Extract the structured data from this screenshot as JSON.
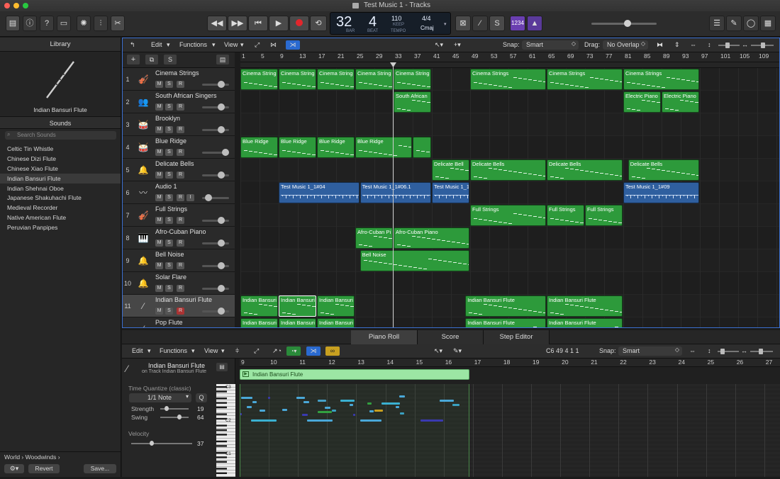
{
  "window": {
    "title": "Test Music 1 - Tracks"
  },
  "lcd": {
    "bar": "32",
    "beat": "4",
    "bar_lbl": "BAR",
    "beat_lbl": "BEAT",
    "tempo": "110",
    "keep": "KEEP",
    "tempo_lbl": "TEMPO",
    "sig": "4/4",
    "key": "Cmaj"
  },
  "controlbar": {
    "midi_badge": "1234"
  },
  "library": {
    "title": "Library",
    "instrument": "Indian Bansuri Flute",
    "sounds_title": "Sounds",
    "search_placeholder": "Search Sounds",
    "sounds": [
      "Celtic Tin Whistle",
      "Chinese Dizi Flute",
      "Chinese Xiao Flute",
      "Indian Bansuri Flute",
      "Indian Shehnai Oboe",
      "Japanese Shakuhachi Flute",
      "Medieval Recorder",
      "Native American Flute",
      "Peruvian Panpipes"
    ],
    "breadcrumb": [
      "World",
      "Woodwinds"
    ],
    "revert": "Revert",
    "save": "Save..."
  },
  "tracks_bar": {
    "edit": "Edit",
    "functions": "Functions",
    "view": "View",
    "snap_lbl": "Snap:",
    "snap": "Smart",
    "drag_lbl": "Drag:",
    "drag": "No Overlap"
  },
  "ruler": [
    "1",
    "5",
    "9",
    "13",
    "17",
    "21",
    "25",
    "29",
    "33",
    "37",
    "41",
    "45",
    "49",
    "53",
    "57",
    "61",
    "65",
    "69",
    "73",
    "77",
    "81",
    "85",
    "89",
    "93",
    "97",
    "101",
    "105",
    "109"
  ],
  "tracks": [
    {
      "num": "1",
      "name": "Cinema Strings",
      "r": "R"
    },
    {
      "num": "2",
      "name": "South African Singers",
      "r": "R"
    },
    {
      "num": "3",
      "name": "Brooklyn",
      "r": "R"
    },
    {
      "num": "4",
      "name": "Blue Ridge",
      "r": "R"
    },
    {
      "num": "5",
      "name": "Delicate Bells",
      "r": "R"
    },
    {
      "num": "6",
      "name": "Audio 1",
      "r": "R",
      "i": "I"
    },
    {
      "num": "7",
      "name": "Full Strings",
      "r": "R"
    },
    {
      "num": "8",
      "name": "Afro-Cuban Piano",
      "r": "R"
    },
    {
      "num": "9",
      "name": "Bell Noise",
      "r": "R"
    },
    {
      "num": "10",
      "name": "Solar Flare",
      "r": "R"
    },
    {
      "num": "11",
      "name": "Indian Bansuri Flute",
      "r": "R"
    },
    {
      "num": "",
      "name": "Pop Flute",
      "r": "R"
    }
  ],
  "track_controls": {
    "m": "M",
    "s": "S"
  },
  "regions": {
    "cinema_strings": "Cinema String",
    "cinema_strings_full": "Cinema Strings",
    "south_african": "South African",
    "electric_piano": "Electric Piano",
    "blue_ridge": "Blue Ridge",
    "delicate_bell": "Delicate Bell",
    "delicate_bells": "Delicate Bells",
    "audio_a": "Test Music 1_1#04",
    "audio_b": "Test Music 1_1#06.1",
    "audio_c": "Test Music 1_1",
    "audio_d": "Test Music 1_1#09",
    "full_strings": "Full Strings",
    "afro_pi": "Afro-Cuban Pi",
    "afro_piano": "Afro-Cuban Piano",
    "bell_noise": "Bell Noise",
    "bansuri": "Indian Bansuri",
    "bansuri_full": "Indian Bansuri Flute"
  },
  "editor": {
    "tabs": [
      "Piano Roll",
      "Score",
      "Step Editor"
    ],
    "edit": "Edit",
    "functions": "Functions",
    "view": "View",
    "position": "C6  49 4 1 1",
    "snap_lbl": "Snap:",
    "snap": "Smart",
    "region_name": "Indian Bansuri Flute",
    "region_track": "on Track Indian Bansuri Flute",
    "tq_label": "Time Quantize (classic)",
    "tq_value": "1/1 Note",
    "q": "Q",
    "strength_lbl": "Strength",
    "strength": "19",
    "swing_lbl": "Swing",
    "swing": "64",
    "velocity_lbl": "Velocity",
    "velocity": "37",
    "ruler": [
      "9",
      "10",
      "11",
      "12",
      "13",
      "14",
      "15",
      "16",
      "17",
      "18",
      "19",
      "20",
      "21",
      "22",
      "23",
      "24",
      "25",
      "26",
      "27"
    ],
    "keys": [
      "C3",
      "C2",
      "C1"
    ],
    "region_label": "Indian Bansuri Flute"
  }
}
